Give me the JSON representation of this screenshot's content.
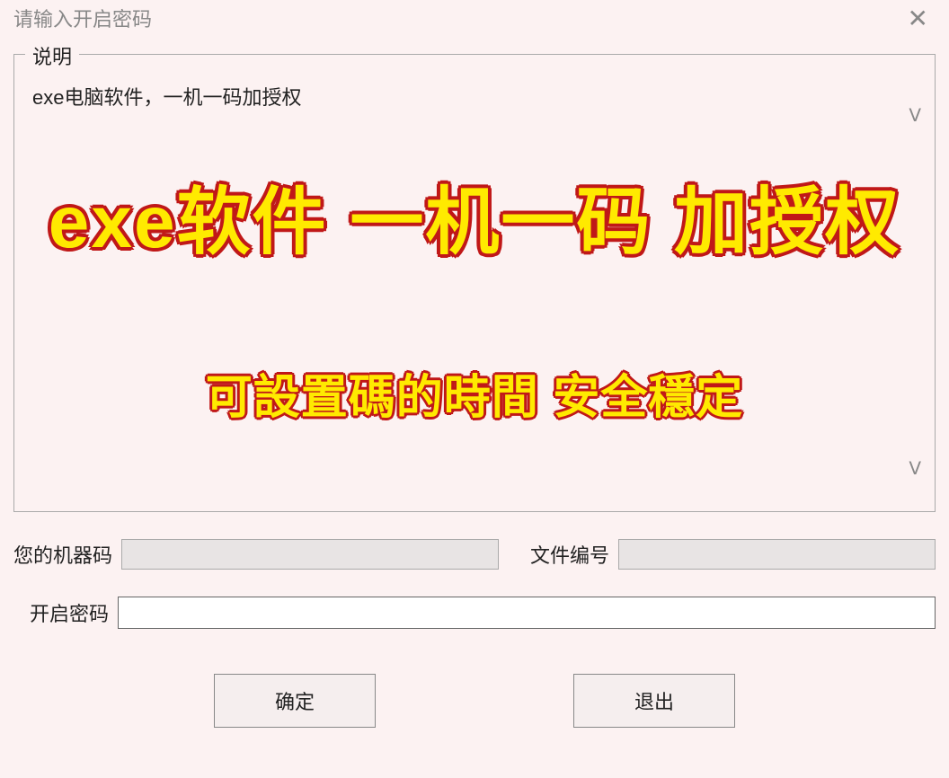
{
  "window": {
    "title": "请输入开启密码"
  },
  "description": {
    "legend": "说明",
    "text": "exe电脑软件，一机一码加授权"
  },
  "overlay": {
    "large_text": "exe软件 一机一码 加授权",
    "small_text": "可設置碼的時間 安全穩定"
  },
  "form": {
    "machine_code_label": "您的机器码",
    "machine_code_value": "",
    "file_number_label": "文件编号",
    "file_number_value": "",
    "password_label": "开启密码",
    "password_value": ""
  },
  "buttons": {
    "confirm": "确定",
    "exit": "退出"
  }
}
